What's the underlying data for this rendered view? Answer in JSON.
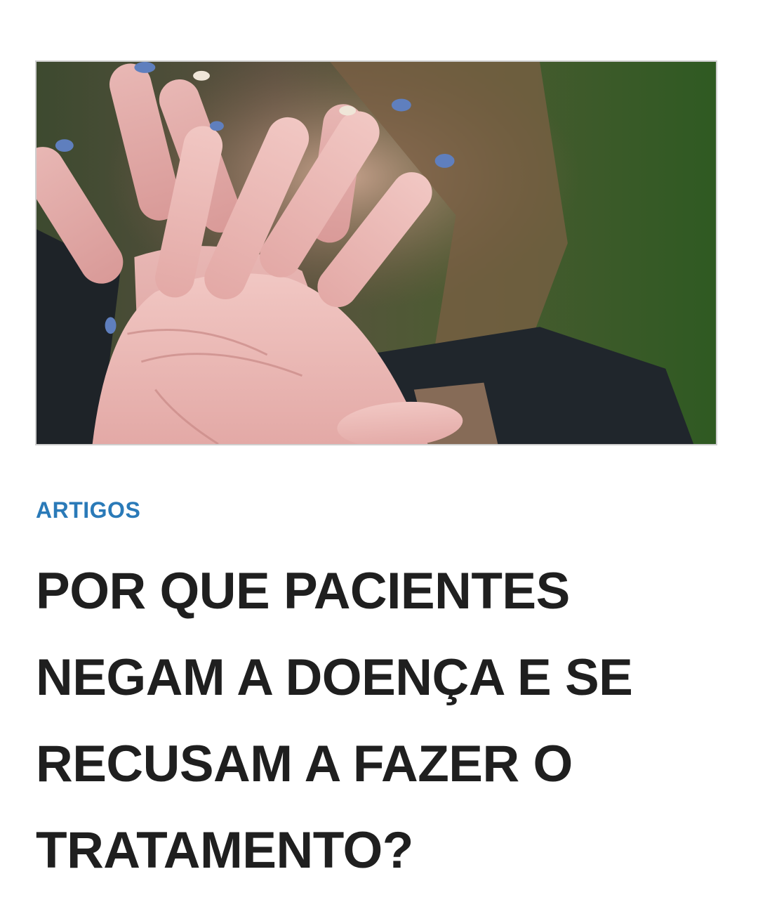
{
  "colors": {
    "accent": "#2a7ab8",
    "text": "#1f1f1f",
    "background": "#ffffff"
  },
  "article": {
    "image": {
      "icon": "photo-hand-refusal"
    },
    "category_label": "ARTIGOS",
    "title_lines": [
      "POR QUE PACIENTES",
      "NEGAM A DOENÇA E SE",
      "RECUSAM A FAZER O",
      "TRATAMENTO?"
    ]
  }
}
